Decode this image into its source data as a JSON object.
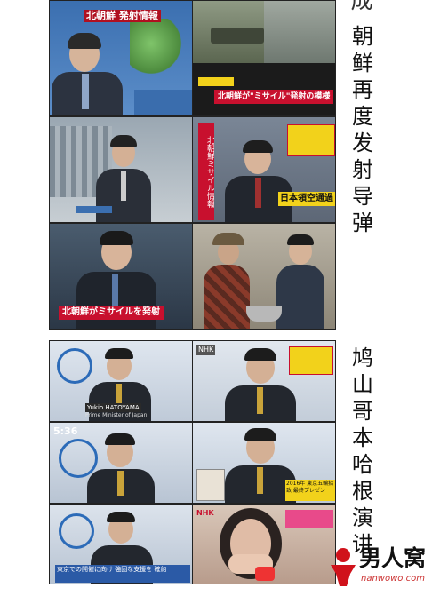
{
  "top_panel": {
    "vertical_caption": "朝鲜再度发射导弹",
    "top_char": "成",
    "frames": [
      {
        "caption": "北朝鮮 発射情報",
        "label": "anchor-map"
      },
      {
        "caption": "北朝鮮が\"ミサイル\"発射の模様",
        "label": "missile-launcher"
      },
      {
        "caption": "北朝鮮ミサイル情報",
        "label": "reporter-outdoor"
      },
      {
        "caption": "日本領空通過",
        "label": "reporter-studio"
      },
      {
        "caption": "北朝鮮がミサイルを発射",
        "label": "anchor-studio"
      },
      {
        "caption": "",
        "label": "cooking-show"
      }
    ]
  },
  "bottom_panel": {
    "vertical_caption": "鸠山哥本哈根演讲",
    "frames": [
      {
        "caption": "Yukio HATOYAMA",
        "subcaption": "Prime Minister of Japan",
        "label": "speech-wide"
      },
      {
        "caption": "NHK",
        "label": "speech-close"
      },
      {
        "caption": "5:36",
        "label": "speech-podium"
      },
      {
        "caption": "2016年 東京五輪招致 最終プレゼン",
        "label": "speech-inset"
      },
      {
        "caption": "東京での開催に向け 強固な支援を 確約",
        "label": "speech-subtitle"
      },
      {
        "caption": "NHK",
        "label": "crying-girl"
      }
    ]
  },
  "watermark": {
    "brand": "男人窝",
    "url": "nanwowo.com"
  },
  "colors": {
    "brand_red": "#d0121b",
    "caption_red": "#c8102e",
    "caption_yellow": "#f2d21b",
    "studio_blue": "#2b5aa6"
  }
}
